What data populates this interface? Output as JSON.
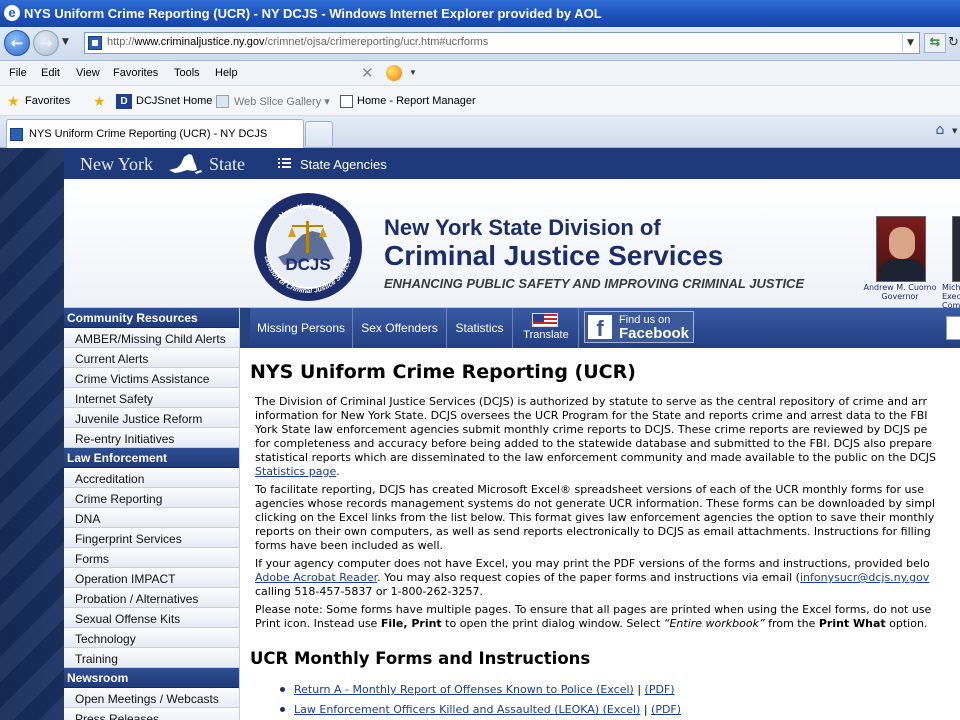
{
  "window": {
    "title": "NYS Uniform Crime Reporting (UCR) - NY DCJS - Windows Internet Explorer provided by AOL"
  },
  "address": {
    "url_prefix": "http://",
    "url_host": "www.criminaljustice.ny.gov",
    "url_path": "/crimnet/ojsa/crimereporting/ucr.htm#ucrforms"
  },
  "menu": [
    "File",
    "Edit",
    "View",
    "Favorites",
    "Tools",
    "Help"
  ],
  "favorites": {
    "label": "Favorites",
    "items": [
      "DCJSnet Home",
      "Web Slice Gallery",
      "Home - Report Manager"
    ]
  },
  "tab": {
    "title": "NYS Uniform Crime Reporting (UCR) - NY DCJS"
  },
  "site": {
    "nys_left": "New York",
    "nys_right": "State",
    "agencies": "State Agencies",
    "banner_line1": "New York State Division of",
    "banner_line2": "Criminal Justice Services",
    "tagline": "ENHANCING PUBLIC SAFETY AND IMPROVING CRIMINAL JUSTICE",
    "seal": {
      "top": "New York State",
      "middle": "DCJS",
      "ring": "Division of Criminal Justice Services"
    },
    "governor_name": "Andrew M. Cuomo",
    "governor_title": "Governor",
    "lg_name_line1": "Mich",
    "lg_name_line2": "Exec",
    "lg_name_line3": "Com"
  },
  "leftnav": {
    "sections": [
      {
        "head": "Community Resources",
        "links": [
          "AMBER/Missing Child Alerts",
          "Current Alerts",
          "Crime Victims Assistance",
          "Internet Safety",
          "Juvenile Justice Reform",
          "Re-entry Initiatives"
        ]
      },
      {
        "head": "Law Enforcement",
        "links": [
          "Accreditation",
          "Crime Reporting",
          "DNA",
          "Fingerprint Services",
          "Forms",
          "Operation IMPACT",
          "Probation / Alternatives",
          "Sexual Offense Kits",
          "Technology",
          "Training"
        ]
      },
      {
        "head": "Newsroom",
        "links": [
          "Open Meetings / Webcasts",
          "Press Releases"
        ]
      }
    ]
  },
  "topnav": {
    "missing_persons": "Missing Persons",
    "sex_offenders": "Sex Offenders",
    "statistics": "Statistics",
    "translate": "Translate",
    "fb_line1": "Find us on",
    "fb_line2": "Facebook"
  },
  "main": {
    "title": "NYS Uniform Crime Reporting (UCR)",
    "p1": [
      "The Division of Criminal Justice Services (DCJS) is authorized by statute to serve as the central repository of crime and arr",
      "information for New York State. DCJS oversees the UCR Program for the State and reports crime and arrest data to the FBI",
      "York State law enforcement agencies submit monthly crime reports to DCJS. These crime reports are reviewed by DCJS pe",
      "for completeness and accuracy before being added to the statewide database and submitted to the FBI. DCJS also prepare",
      "statistical reports which are disseminated to the law enforcement community and made available to the public on the DCJS"
    ],
    "p1_link": "Statistics page",
    "p1_tail": ".",
    "p2": [
      "To facilitate reporting, DCJS has created Microsoft Excel® spreadsheet versions of each of the UCR monthly forms for use",
      "agencies whose records management systems do not generate UCR information. These forms can be downloaded by simpl",
      "clicking on the Excel links from the list below. This format gives law enforcement agencies the option to save their monthly",
      "reports on their own computers, as well as send reports electronically to DCJS as email attachments.  Instructions for filling",
      "forms have been included as well."
    ],
    "p3_line1": "If your agency computer does not have Excel, you may print the PDF versions of the forms and instructions, provided belo",
    "p3_link1": "Adobe Acrobat Reader",
    "p3_mid": ". You may also request copies of the paper forms and instructions via email (",
    "p3_link2": "infonysucr@dcjs.ny.gov",
    "p3_line3": "calling 518-457-5837 or 1-800-262-3257.",
    "p4_a": "Please note: Some forms have multiple pages. To ensure that all pages are printed when using the Excel forms, do not use",
    "p4_b1": "Print icon. Instead use ",
    "p4_b2": "File, Print",
    "p4_b3": " to open the print dialog window.  Select ",
    "p4_b4": "“Entire workbook”",
    "p4_b5": " from the ",
    "p4_b6": "Print What",
    "p4_b7": " option.",
    "section_title": "UCR Monthly Forms and Instructions",
    "forms": [
      {
        "name": "Return A - Monthly Report of Offenses Known to Police (Excel)",
        "sep": " | ",
        "pdf": "(PDF)"
      },
      {
        "name": "Law Enforcement Officers Killed and Assaulted (LEOKA) (Excel)",
        "sep": " | ",
        "pdf": "(PDF)"
      }
    ]
  }
}
